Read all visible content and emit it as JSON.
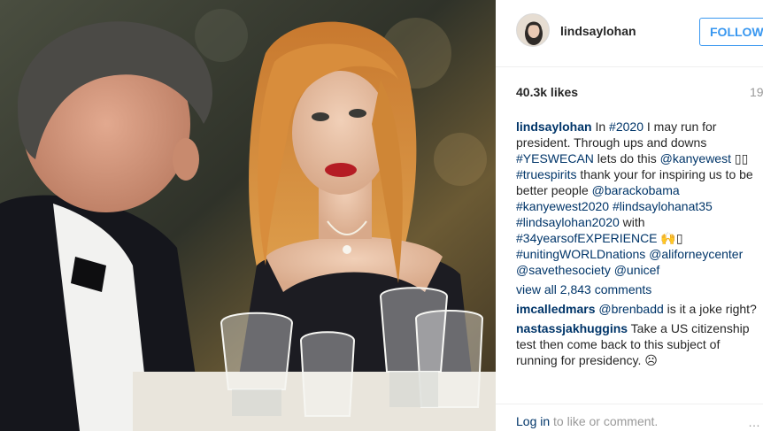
{
  "post": {
    "username": "lindsaylohan",
    "follow_label": "FOLLOW",
    "likes": "40.3k likes",
    "time": "19",
    "caption": {
      "user": "lindsaylohan",
      "parts": [
        {
          "t": "text",
          "v": " In "
        },
        {
          "t": "tag",
          "v": "#2020"
        },
        {
          "t": "text",
          "v": " I may run for president. Through ups and downs "
        },
        {
          "t": "tag",
          "v": "#YESWECAN"
        },
        {
          "t": "text",
          "v": " lets do this "
        },
        {
          "t": "tag",
          "v": "@kanyewest"
        },
        {
          "t": "text",
          "v": " ▯▯ "
        },
        {
          "t": "tag",
          "v": "#truespirits"
        },
        {
          "t": "text",
          "v": " thank your for inspiring us to be better people "
        },
        {
          "t": "tag",
          "v": "@barackobama"
        },
        {
          "t": "text",
          "v": " "
        },
        {
          "t": "tag",
          "v": "#kanyewest2020"
        },
        {
          "t": "text",
          "v": " "
        },
        {
          "t": "tag",
          "v": "#lindsaylohanat35"
        },
        {
          "t": "text",
          "v": " "
        },
        {
          "t": "tag",
          "v": "#lindsaylohan2020"
        },
        {
          "t": "text",
          "v": " with "
        },
        {
          "t": "tag",
          "v": "#34yearsofEXPERIENCE"
        },
        {
          "t": "text",
          "v": " 🙌▯ "
        },
        {
          "t": "tag",
          "v": "#unitingWORLDnations"
        },
        {
          "t": "text",
          "v": " "
        },
        {
          "t": "tag",
          "v": "@aliforneycenter"
        },
        {
          "t": "text",
          "v": " "
        },
        {
          "t": "tag",
          "v": "@savethesociety"
        },
        {
          "t": "text",
          "v": " "
        },
        {
          "t": "tag",
          "v": "@unicef"
        }
      ]
    },
    "view_all": "view all 2,843 comments",
    "comments": [
      {
        "user": "imcalledmars",
        "mention": "@brenbadd",
        "text": " is it a joke right?"
      },
      {
        "user": "nastassjakhuggins",
        "mention": "",
        "text": " Take a US citizenship test then come back to this subject of running for presidency. ☹"
      }
    ],
    "login_link": "Log in",
    "login_rest": " to like or comment.",
    "more": "…"
  }
}
